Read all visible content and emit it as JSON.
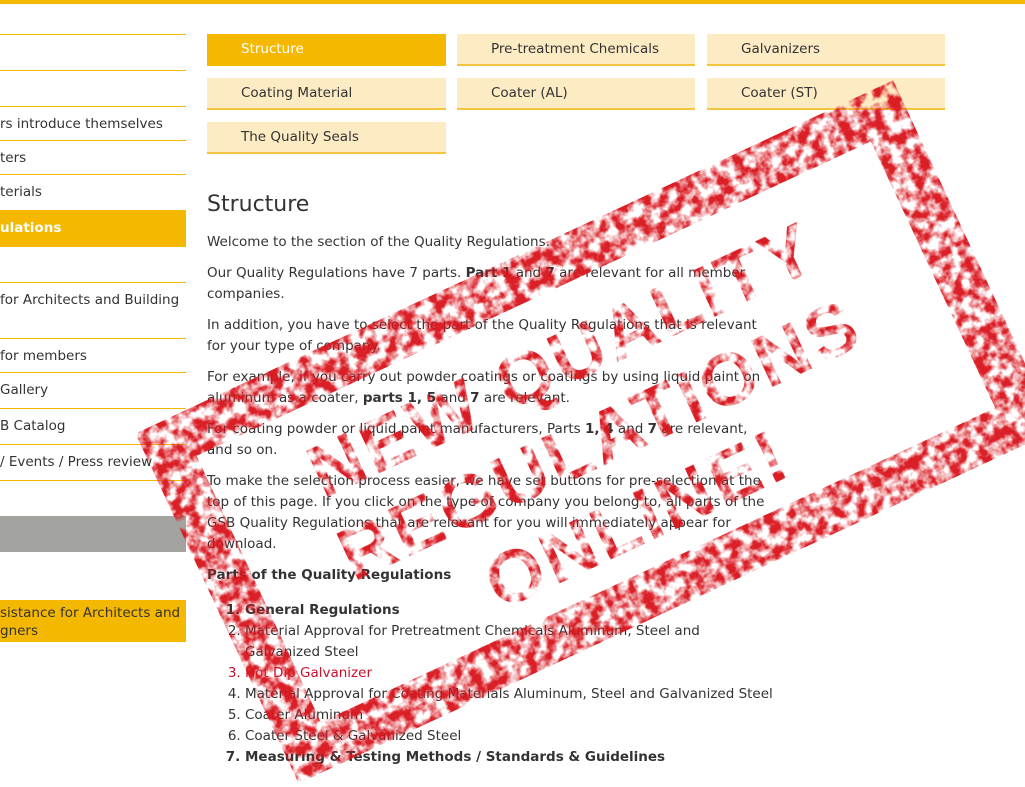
{
  "colors": {
    "accent": "#f5b800",
    "tab_bg": "#fdebc4",
    "stamp": "#d8141c",
    "link_red": "#c8102e"
  },
  "sidebar": {
    "items": [
      {
        "label": ""
      },
      {
        "label": ""
      },
      {
        "label": "rs introduce themselves"
      },
      {
        "label": "ters"
      },
      {
        "label": "terials"
      },
      {
        "label": "ulations"
      },
      {
        "label": ""
      },
      {
        "label": "for Architects and Building"
      },
      {
        "label": "for members"
      },
      {
        "label": "Gallery"
      },
      {
        "label": "B Catalog"
      },
      {
        "label": "/ Events / Press review"
      },
      {
        "label": ""
      },
      {
        "label": ""
      },
      {
        "label": "sistance for Architects and gners"
      }
    ]
  },
  "tabs": [
    {
      "label": "Structure"
    },
    {
      "label": "Pre-treatment Chemicals"
    },
    {
      "label": "Galvanizers"
    },
    {
      "label": "Coating Material"
    },
    {
      "label": "Coater (AL)"
    },
    {
      "label": "Coater (ST)"
    },
    {
      "label": "The Quality Seals"
    }
  ],
  "content": {
    "title": "Structure",
    "p1": "Welcome to the section of the Quality Regulations.",
    "p2_a": "Our Quality Regulations have 7 parts. ",
    "p2_b": "Part 1",
    "p2_c": " and ",
    "p2_d": "7",
    "p2_e": " are relevant for all member companies.",
    "p3": "In addition, you have to select the part of the Quality Regulations that is relevant for your type of company.",
    "p4_a": "For example, if you carry out powder coatings or coatings by using liquid paint on aluminum as a coater, ",
    "p4_b": "parts 1, 5",
    "p4_c": " and ",
    "p4_d": "7",
    "p4_e": " are relevant.",
    "p5_a": "For coating powder or liquid paint manufacturers, Parts ",
    "p5_b": "1, 4",
    "p5_c": " and ",
    "p5_d": "7",
    "p5_e": " are relevant, and so on.",
    "p6": "To make the selection process easier, we have set buttons for pre-selection at the top of this page. If you click on the type of company you belong to, all parts of the GSB Quality Regulations that are relevant for you will immediately appear for download.",
    "parts_heading": "Parts of the Quality Regulations",
    "parts": [
      "General Regulations",
      "Material Approval for Pretreatment Chemicals Aluminum, Steel and Galvanized Steel",
      "Hot Dip Galvanizer",
      "Material Approval for Coating Materials Aluminum, Steel and Galvanized Steel",
      "Coater Aluminum",
      "Coater Steel & Galvanized Steel",
      "Measuring & Testing Methods / Standards & Guidelines"
    ]
  },
  "stamp": {
    "line1": "NEW QUALITY",
    "line2": "REGULATIONS",
    "line3": "ONLINE!"
  }
}
